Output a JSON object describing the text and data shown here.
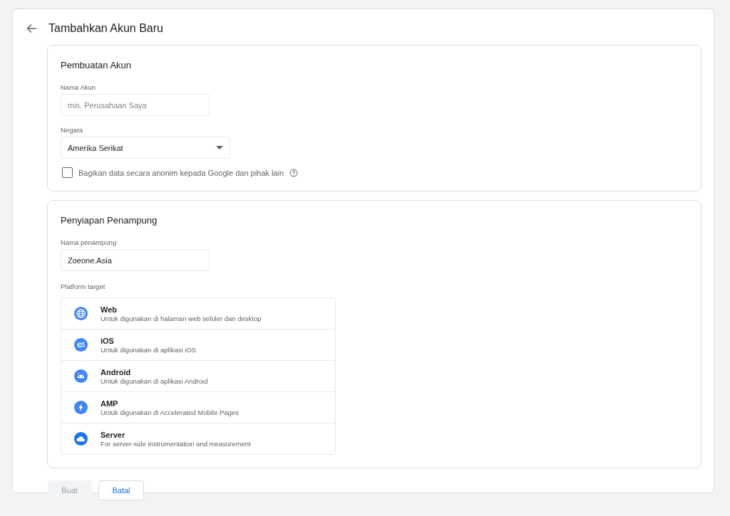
{
  "header": {
    "title": "Tambahkan Akun Baru"
  },
  "account_section": {
    "title": "Pembuatan Akun",
    "name_field": {
      "label": "Nama Akun",
      "placeholder": "mis. Perusahaan Saya"
    },
    "country_field": {
      "label": "Negara",
      "value": "Amerika Serikat"
    },
    "share_checkbox": {
      "label": "Bagikan data secara anonim kepada Google dan pihak lain",
      "checked": false
    }
  },
  "container_section": {
    "title": "Penyiapan Penampung",
    "name_field": {
      "label": "Nama penampung",
      "value": "Zoeone.Asia"
    },
    "platform_label": "Platform target",
    "platforms": [
      {
        "kind": "web",
        "name": "Web",
        "description": "Untuk digunakan di halaman web seluler dan desktop"
      },
      {
        "kind": "ios",
        "name": "iOS",
        "description": "Untuk digunakan di aplikasi iOS"
      },
      {
        "kind": "android",
        "name": "Android",
        "description": "Untuk digunakan di aplikasi Android"
      },
      {
        "kind": "amp",
        "name": "AMP",
        "description": "Untuk digunakan di Accelerated Mobile Pages"
      },
      {
        "kind": "server",
        "name": "Server",
        "description": "For server-side instrumentation and measurement"
      }
    ]
  },
  "buttons": [
    {
      "label": "Buat",
      "kind": "primary",
      "disabled": true
    },
    {
      "label": "Batal",
      "kind": "secondary",
      "disabled": false
    }
  ]
}
